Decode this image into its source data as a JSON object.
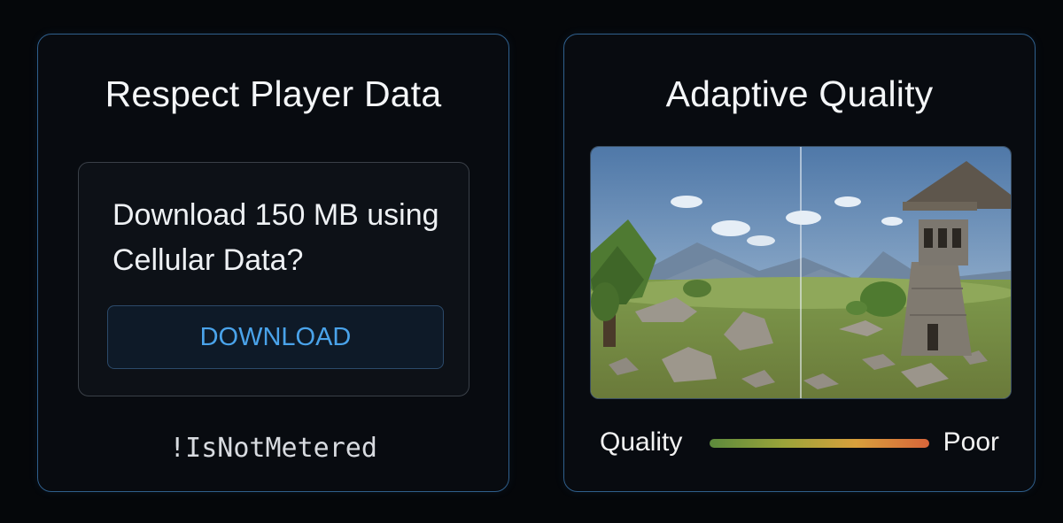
{
  "left_card": {
    "title": "Respect Player Data",
    "dialog": {
      "message": "Download 150 MB using Cellular Data?",
      "button_label": "DOWNLOAD"
    },
    "code_label": "!IsNotMetered"
  },
  "right_card": {
    "title": "Adaptive Quality",
    "quality_scale": {
      "left_label": "Quality",
      "right_label": "Poor"
    }
  },
  "colors": {
    "accent_blue": "#4aa3ea",
    "card_border": "#2f5f8c",
    "background": "#05070a"
  }
}
